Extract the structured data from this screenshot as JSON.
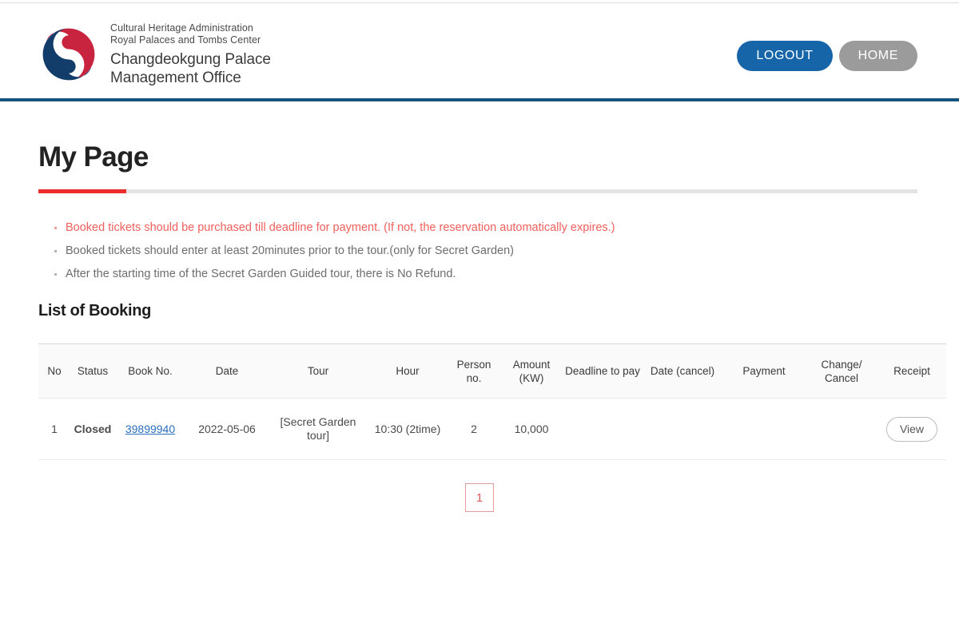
{
  "header": {
    "logo_icon": "taegeuk-government-emblem",
    "org_line1": "Cultural Heritage Administration",
    "org_line2": "Royal Palaces and Tombs Center",
    "office_line1": "Changdeokgung Palace",
    "office_line2": "Management Office",
    "logout_label": "LOGOUT",
    "home_label": "HOME",
    "accent_blue": "#1565a8",
    "accent_gray": "#9b9b9b",
    "band_color": "#14547f"
  },
  "page": {
    "title": "My Page",
    "rule_accent_color": "#ec2d2d",
    "rule_color": "#e4e4e4"
  },
  "notices": [
    {
      "text": "Booked tickets should be purchased till deadline for payment. (If not, the reservation automatically expires.)",
      "highlight": true
    },
    {
      "text": "Booked tickets should enter at least 20minutes prior to the tour.(only for Secret Garden)",
      "highlight": false
    },
    {
      "text": "After the starting time of the Secret Garden Guided tour, there is No Refund.",
      "highlight": false
    }
  ],
  "booking": {
    "section_title": "List of Booking",
    "columns": [
      "No",
      "Status",
      "Book No.",
      "Date",
      "Tour",
      "Hour",
      "Person no.",
      "Amount (KW)",
      "Deadline to pay",
      "Date (cancel)",
      "Payment",
      "Change/ Cancel",
      "Receipt"
    ],
    "rows": [
      {
        "no": "1",
        "status": "Closed",
        "book_no": "39899940",
        "date": "2022-05-06",
        "tour": "[Secret Garden tour]",
        "hour": "10:30 (2time)",
        "person_no": "2",
        "amount": "10,000",
        "deadline_to_pay": "",
        "date_cancel": "",
        "payment": "",
        "change_cancel": "",
        "receipt_label": "View"
      }
    ],
    "amount_color": "#e8645f",
    "link_color": "#2a6ebb"
  },
  "pagination": {
    "current": "1",
    "border_color": "#e09a9a",
    "text_color": "#e05a5a"
  }
}
